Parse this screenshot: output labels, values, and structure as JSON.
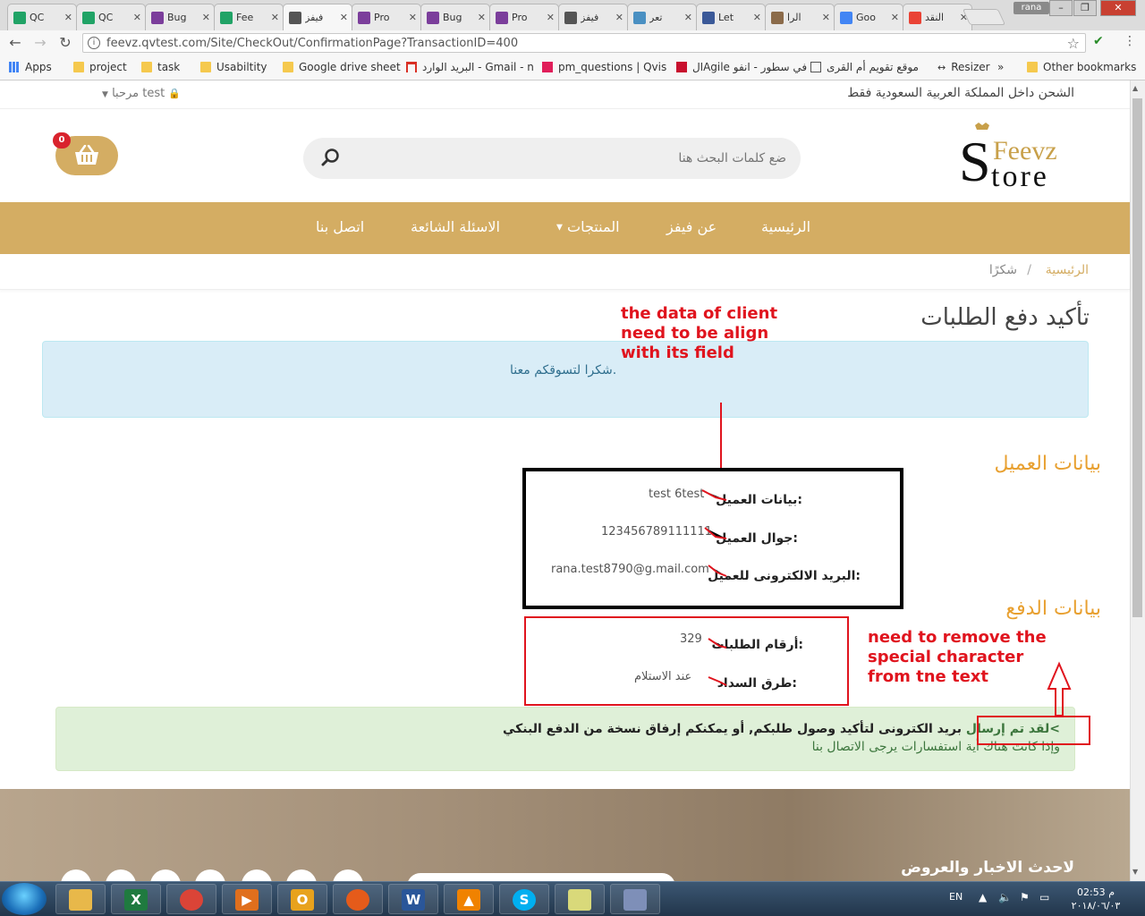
{
  "browser": {
    "tabs": [
      {
        "label": "QC",
        "icon": "sheets-icon",
        "color": "#21a366"
      },
      {
        "label": "QC",
        "icon": "sheets-icon",
        "color": "#21a366"
      },
      {
        "label": "Bug",
        "icon": "vs-icon",
        "color": "#7b3e9b"
      },
      {
        "label": "Fee",
        "icon": "sheets-icon",
        "color": "#21a366"
      },
      {
        "label": "فيفز",
        "icon": "dollar-icon",
        "color": "#555555",
        "active": true
      },
      {
        "label": "Pro",
        "icon": "vs-icon",
        "color": "#7b3e9b"
      },
      {
        "label": "Bug",
        "icon": "vs-icon",
        "color": "#7b3e9b"
      },
      {
        "label": "Pro",
        "icon": "vs-icon",
        "color": "#7b3e9b"
      },
      {
        "label": "فيفز",
        "icon": "dollar-icon",
        "color": "#555555"
      },
      {
        "label": "تعر",
        "icon": "book-icon",
        "color": "#4a90c2"
      },
      {
        "label": "Let",
        "icon": "facebook-icon",
        "color": "#3b5998"
      },
      {
        "label": "الرا",
        "icon": "quill-icon",
        "color": "#8b6b4a"
      },
      {
        "label": "Goo",
        "icon": "translate-icon",
        "color": "#4285f4"
      },
      {
        "label": "النقد",
        "icon": "google-icon",
        "color": "#ea4335"
      }
    ],
    "user_chip": "rana",
    "url": "feevz.qvtest.com/Site/CheckOut/ConfirmationPage?TransactionID=400",
    "bookmarks": [
      {
        "label": "Apps",
        "icon": "apps-icon"
      },
      {
        "label": "project",
        "icon": "folder-icon"
      },
      {
        "label": "task",
        "icon": "folder-icon"
      },
      {
        "label": "Usabiltity",
        "icon": "folder-icon"
      },
      {
        "label": "Google drive sheet",
        "icon": "folder-icon"
      },
      {
        "label": "البريد الوارد - Gmail - n",
        "icon": "gmail-icon"
      },
      {
        "label": "pm_questions | Qvis",
        "icon": "slack-icon"
      },
      {
        "label": "الAgile في سطور - انفو",
        "icon": "info-icon"
      },
      {
        "label": "موقع تقويم أم القرى",
        "icon": "page-icon"
      },
      {
        "label": "Resizer",
        "icon": "arrows-icon"
      },
      {
        "label": "»",
        "icon": ""
      },
      {
        "label": "Other bookmarks",
        "icon": "folder-icon"
      }
    ]
  },
  "site": {
    "shipping_note": "الشحن داخل المملكة العربية السعودية فقط",
    "user_menu": "مرحبا test",
    "search_placeholder": "ضع كلمات البحث هنا",
    "cart_count": "0",
    "logo_text_top": "Feevz",
    "logo_text_bottom": "tore",
    "logo_initial": "S",
    "nav": [
      "الرئيسية",
      "عن فيفز",
      "المنتجات",
      "الاسئلة الشائعة",
      "اتصل بنا"
    ],
    "breadcrumb": {
      "home": "الرئيسية",
      "separator": "/",
      "current": "شكرًا"
    },
    "page_title": "تأكيد دفع الطلبات",
    "thanks_message": "شكرا لتسوقكم معنا.",
    "client_section_title": "بيانات العميل",
    "client_fields": [
      {
        "label": "بيانات العميل:",
        "value": "test 6test"
      },
      {
        "label": "جوال العميل:",
        "value": "123456789111111"
      },
      {
        "label": "البريد الالكترونى للعميل:",
        "value": "rana.test8790@g.mail.com"
      }
    ],
    "payment_section_title": "بيانات الدفع",
    "payment_fields": [
      {
        "label": "أرقام الطلبات:",
        "value": "329"
      },
      {
        "label": "طرق السداد:",
        "value": "عند الاستلام"
      }
    ],
    "success_line1_green": ">لقد تم إرسال",
    "success_line1_rest": "بريد الكترونى لتأكيد وصول طلبكم, أو يمكنكم إرفاق نسخة من الدفع البنكي",
    "success_line2": "وإذا كانت هناك أية استفسارات يرجى الاتصال بنا",
    "footer_news_title": "لاحدث الاخبار والعروض"
  },
  "annotations": {
    "note_alignment": [
      "the data of client",
      "need to be align",
      "with its field"
    ],
    "note_special_char": [
      "need to remove the",
      "special character",
      "from tne text"
    ],
    "color": "#e0141e"
  },
  "taskbar": {
    "apps": [
      {
        "name": "explorer-icon",
        "color": "#e8b84a",
        "glyph": ""
      },
      {
        "name": "excel-icon",
        "color": "#1f7a3f",
        "glyph": "X"
      },
      {
        "name": "chrome-icon",
        "color": "#db4437",
        "glyph": ""
      },
      {
        "name": "media-icon",
        "color": "#e06f1d",
        "glyph": "▶"
      },
      {
        "name": "outlook-icon",
        "color": "#e8a21d",
        "glyph": "O"
      },
      {
        "name": "firefox-icon",
        "color": "#e55b1a",
        "glyph": ""
      },
      {
        "name": "word-icon",
        "color": "#2a5699",
        "glyph": "W"
      },
      {
        "name": "vlc-icon",
        "color": "#f08200",
        "glyph": "▲"
      },
      {
        "name": "skype-icon",
        "color": "#00aff0",
        "glyph": "S"
      },
      {
        "name": "notes-icon",
        "color": "#d9d97a",
        "glyph": ""
      },
      {
        "name": "paint-icon",
        "color": "#7e8fb8",
        "glyph": ""
      }
    ],
    "language": "EN",
    "clock_time": "02:53 م",
    "clock_date": "٢٠١٨/٠٦/٠٣"
  }
}
